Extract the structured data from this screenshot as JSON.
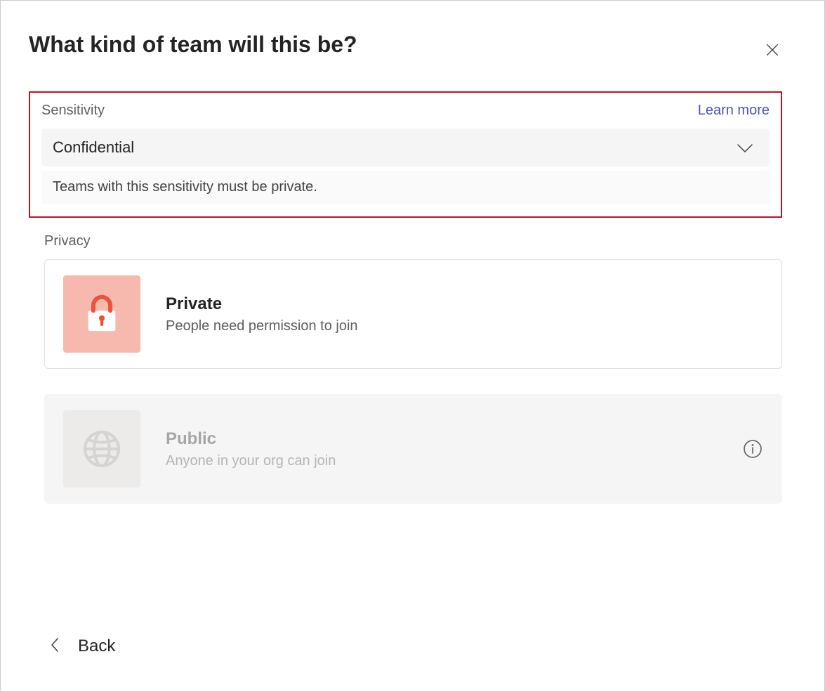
{
  "dialog": {
    "title": "What kind of team will this be?"
  },
  "sensitivity": {
    "label": "Sensitivity",
    "learn_more": "Learn more",
    "selected": "Confidential",
    "helper": "Teams with this sensitivity must be private."
  },
  "privacy": {
    "label": "Privacy",
    "options": [
      {
        "title": "Private",
        "description": "People need permission to join"
      },
      {
        "title": "Public",
        "description": "Anyone in your org can join"
      }
    ]
  },
  "footer": {
    "back": "Back"
  }
}
